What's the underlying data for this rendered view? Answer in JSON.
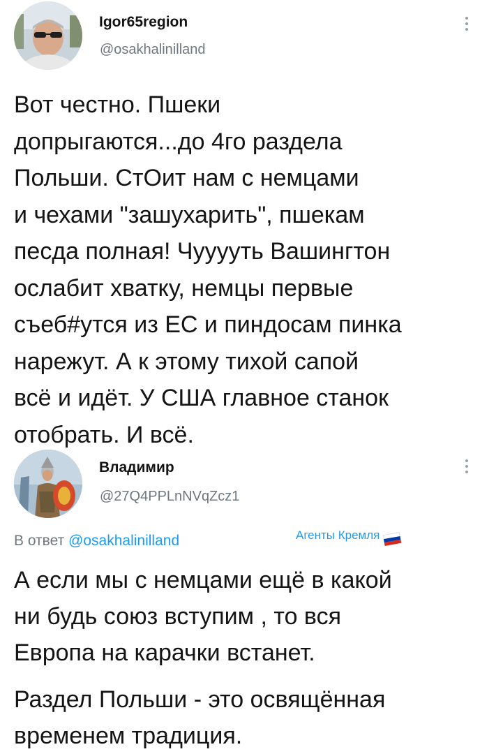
{
  "tweet1": {
    "display_name": "Igor65region",
    "handle": "@osakhalinilland",
    "avatar_icon": "user-avatar-photo",
    "more_icon": "vertical-dots-icon",
    "text": "Вот честно. Пшеки\nдопрыгаются...до 4го раздела\nПольши. СтОит нам с немцами\nи чехами \"зашухарить\", пшекам\nпесда полная! Чууууть Вашингтон\nослабит хватку, немцы первые\nсъеб#утся из ЕС и пиндосам пинка\nнарежут. А к этому тихой сапой\nвсё и идёт. У США главное станок\nотобрать. И всё."
  },
  "tweet2": {
    "display_name": "Владимир",
    "handle": "@27Q4PPLnNVqZcz1",
    "avatar_icon": "user-avatar-knight",
    "more_icon": "vertical-dots-icon",
    "reply_prefix": "В ответ ",
    "reply_handle": "@osakhalinilland",
    "tag_label": "Агенты Кремля",
    "tag_icon": "russian-flag-icon",
    "paragraph1": "А если мы с немцами ещё в какой\nни будь союз вступим , то вся\nЕвропа на карачки встанет.",
    "paragraph2": "Раздел Польши - это освящённая\nвременем традиция."
  },
  "colors": {
    "link": "#1d9bf0",
    "muted": "#6f7780",
    "text": "#141414",
    "flag": [
      "#ffffff",
      "#0039a6",
      "#d52b1e"
    ]
  }
}
